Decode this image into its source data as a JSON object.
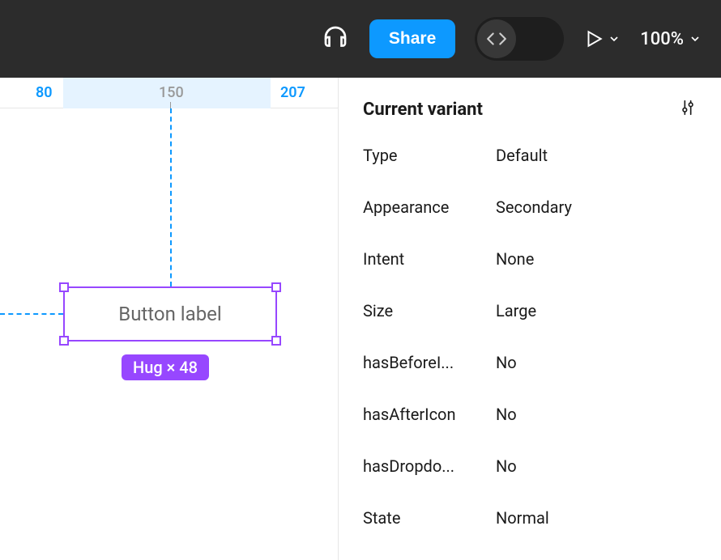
{
  "toolbar": {
    "share_label": "Share",
    "zoom_label": "100%"
  },
  "ruler": {
    "start": "80",
    "mid": "150",
    "end": "207"
  },
  "canvas": {
    "element_label": "Button label",
    "size_badge": "Hug × 48"
  },
  "inspector": {
    "title": "Current variant",
    "props": [
      {
        "label": "Type",
        "value": "Default"
      },
      {
        "label": "Appearance",
        "value": "Secondary"
      },
      {
        "label": "Intent",
        "value": "None"
      },
      {
        "label": "Size",
        "value": "Large"
      },
      {
        "label": "hasBeforeI...",
        "value": "No"
      },
      {
        "label": "hasAfterIcon",
        "value": "No"
      },
      {
        "label": "hasDropdo...",
        "value": "No"
      },
      {
        "label": "State",
        "value": "Normal"
      }
    ]
  }
}
